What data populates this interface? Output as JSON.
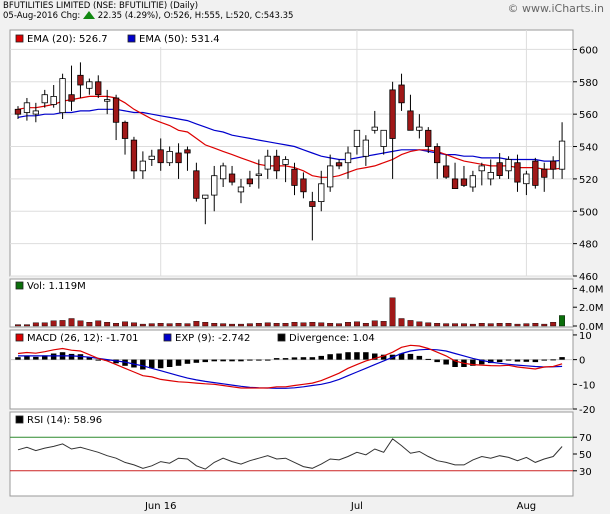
{
  "header": {
    "title": "BFUTILITIES LIMITED (NSE: BFUTILITIE) (Daily)",
    "date": "05-Aug-2016",
    "chg_label": "Chg:",
    "chg_value": "22.35 (4.29%)",
    "ohlc": ", O:526, H:555, L:520, C:543.35",
    "watermark": "© www.iCharts.in"
  },
  "colors": {
    "up": "#ffffff",
    "down": "#a01818",
    "ema20": "#dd0000",
    "ema50": "#0000cc",
    "volume": "#a01818",
    "volume_up": "#0a6e0a",
    "macd": "#000000",
    "rsi_upper": "#2f8a2f",
    "rsi_lower": "#cc2222",
    "chg_arrow": "#118811"
  },
  "chart_data": [
    {
      "type": "candlestick",
      "legend": [
        {
          "name": "EMA (20): 526.7",
          "color": "#dd0000"
        },
        {
          "name": "EMA (50): 531.4",
          "color": "#0000cc"
        }
      ],
      "yticks": [
        460,
        480,
        500,
        520,
        540,
        560,
        580,
        600
      ],
      "ylim": [
        460,
        612
      ],
      "xticks": [
        {
          "label": "Jun 16",
          "i": 16
        },
        {
          "label": "Jul",
          "i": 38
        },
        {
          "label": "Aug",
          "i": 57
        }
      ],
      "ohlc": [
        [
          563,
          565,
          557,
          560
        ],
        [
          561,
          570,
          556,
          567
        ],
        [
          560,
          567,
          555,
          562
        ],
        [
          567,
          575,
          564,
          572
        ],
        [
          566,
          578,
          564,
          571
        ],
        [
          561,
          585,
          557,
          582
        ],
        [
          572,
          590,
          562,
          568
        ],
        [
          584,
          592,
          570,
          578
        ],
        [
          576,
          582,
          572,
          580
        ],
        [
          580,
          584,
          570,
          572
        ],
        [
          568,
          575,
          560,
          569
        ],
        [
          570,
          572,
          544,
          555
        ],
        [
          555,
          556,
          535,
          545
        ],
        [
          544,
          546,
          520,
          525
        ],
        [
          525,
          537,
          520,
          531
        ],
        [
          532,
          538,
          528,
          534
        ],
        [
          538,
          545,
          525,
          530
        ],
        [
          530,
          540,
          528,
          537
        ],
        [
          536,
          542,
          520,
          530
        ],
        [
          538,
          540,
          525,
          536
        ],
        [
          525,
          530,
          506,
          508
        ],
        [
          508,
          510,
          492,
          510
        ],
        [
          510,
          528,
          500,
          522
        ],
        [
          520,
          530,
          515,
          528
        ],
        [
          523,
          528,
          516,
          518
        ],
        [
          512,
          520,
          505,
          515
        ],
        [
          520,
          525,
          515,
          517
        ],
        [
          522,
          532,
          514,
          523
        ],
        [
          526,
          538,
          520,
          534
        ],
        [
          534,
          538,
          520,
          525
        ],
        [
          529,
          534,
          518,
          532
        ],
        [
          526,
          530,
          510,
          516
        ],
        [
          520,
          524,
          508,
          512
        ],
        [
          506,
          512,
          482,
          503
        ],
        [
          506,
          525,
          500,
          517
        ],
        [
          515,
          535,
          512,
          528
        ],
        [
          530,
          532,
          526,
          528
        ],
        [
          530,
          540,
          520,
          536
        ],
        [
          540,
          550,
          535,
          550
        ],
        [
          534,
          547,
          528,
          544
        ],
        [
          550,
          562,
          548,
          552
        ],
        [
          540,
          548,
          535,
          550
        ],
        [
          575,
          580,
          520,
          545
        ],
        [
          578,
          585,
          562,
          567
        ],
        [
          562,
          572,
          550,
          550
        ],
        [
          550,
          560,
          545,
          552
        ],
        [
          550,
          552,
          536,
          540
        ],
        [
          540,
          542,
          520,
          530
        ],
        [
          528,
          535,
          520,
          521
        ],
        [
          520,
          530,
          514,
          514
        ],
        [
          520,
          528,
          515,
          516
        ],
        [
          515,
          525,
          512,
          522
        ],
        [
          525,
          530,
          516,
          528
        ],
        [
          520,
          532,
          516,
          524
        ],
        [
          530,
          536,
          520,
          522
        ],
        [
          525,
          534,
          520,
          532
        ],
        [
          530,
          535,
          512,
          518
        ],
        [
          517,
          525,
          510,
          523
        ],
        [
          531,
          533,
          514,
          516
        ],
        [
          526,
          530,
          512,
          521
        ],
        [
          531,
          534,
          520,
          526
        ],
        [
          526,
          555,
          520,
          543.35
        ]
      ],
      "ema20": [
        563,
        564,
        564,
        565,
        566,
        568,
        569,
        570,
        571,
        571,
        571,
        570,
        567,
        563,
        560,
        557,
        555,
        553,
        550,
        549,
        545,
        541,
        539,
        537,
        535,
        533,
        531,
        529,
        528,
        528,
        528,
        527,
        525,
        522,
        521,
        521,
        522,
        524,
        526,
        527,
        528,
        530,
        532,
        535,
        537,
        538,
        538,
        537,
        535,
        533,
        531,
        530,
        529,
        528,
        528,
        528,
        527,
        527,
        527,
        526,
        526,
        526.7
      ],
      "ema50": [
        558,
        559,
        559,
        560,
        560,
        561,
        561,
        562,
        562,
        563,
        563,
        563,
        562,
        561,
        561,
        560,
        559,
        558,
        557,
        556,
        554,
        552,
        550,
        549,
        547,
        546,
        545,
        544,
        543,
        542,
        541,
        540,
        538,
        536,
        534,
        533,
        532,
        532,
        533,
        534,
        535,
        536,
        537,
        538,
        538,
        538,
        537,
        536,
        535,
        535,
        534,
        534,
        533,
        533,
        533,
        532,
        532,
        532,
        532,
        531,
        531,
        531.4
      ]
    },
    {
      "type": "bar",
      "name": "Vol: 1.119M",
      "yticks": [
        "0.0M",
        "2.0M",
        "4.0M"
      ],
      "ylim": [
        0,
        5
      ],
      "values": [
        0.15,
        0.15,
        0.35,
        0.35,
        0.55,
        0.6,
        0.8,
        0.55,
        0.4,
        0.55,
        0.4,
        0.3,
        0.45,
        0.35,
        0.2,
        0.25,
        0.3,
        0.25,
        0.3,
        0.25,
        0.5,
        0.4,
        0.3,
        0.25,
        0.2,
        0.2,
        0.25,
        0.3,
        0.35,
        0.3,
        0.3,
        0.4,
        0.35,
        0.4,
        0.35,
        0.3,
        0.25,
        0.4,
        0.45,
        0.3,
        0.55,
        0.5,
        3.0,
        0.8,
        0.6,
        0.45,
        0.35,
        0.3,
        0.25,
        0.25,
        0.25,
        0.2,
        0.3,
        0.25,
        0.3,
        0.3,
        0.2,
        0.25,
        0.3,
        0.2,
        0.4,
        1.119
      ]
    },
    {
      "type": "line",
      "legend": [
        {
          "name": "MACD (26, 12): -1.701",
          "color": "#dd0000"
        },
        {
          "name": "EXP (9): -2.742",
          "color": "#0000cc"
        },
        {
          "name": "Divergence: 1.04",
          "color": "#000000"
        }
      ],
      "yticks": [
        -20,
        -10,
        0,
        10
      ],
      "ylim": [
        -20,
        12
      ],
      "macd": [
        2.5,
        2.9,
        2.6,
        3.2,
        4.0,
        4.5,
        3.8,
        3.5,
        2.0,
        0.5,
        -0.5,
        -2.0,
        -3.5,
        -5.0,
        -6.5,
        -7.0,
        -8.0,
        -8.5,
        -9.0,
        -9.2,
        -9.5,
        -9.8,
        -10.0,
        -10.5,
        -11.0,
        -11.5,
        -11.5,
        -11.5,
        -11.5,
        -11.0,
        -11.0,
        -10.5,
        -10.0,
        -9.5,
        -8.5,
        -7.0,
        -5.5,
        -3.5,
        -2.0,
        -0.5,
        0.5,
        1.5,
        3.0,
        5.0,
        5.8,
        5.5,
        4.5,
        3.0,
        1.5,
        -0.5,
        -1.5,
        -2.0,
        -2.2,
        -2.4,
        -2.5,
        -2.3,
        -3.0,
        -3.4,
        -3.8,
        -3.0,
        -2.8,
        -1.701
      ],
      "exp": [
        1.5,
        1.5,
        1.5,
        1.5,
        1.5,
        1.5,
        1.5,
        1.3,
        1.0,
        0.5,
        0.0,
        -0.5,
        -1.0,
        -1.8,
        -2.5,
        -3.5,
        -4.5,
        -5.5,
        -6.5,
        -7.5,
        -8.2,
        -8.8,
        -9.3,
        -9.8,
        -10.3,
        -10.8,
        -11.2,
        -11.4,
        -11.5,
        -11.6,
        -11.6,
        -11.4,
        -11.0,
        -10.5,
        -10.0,
        -9.2,
        -8.0,
        -6.5,
        -5.0,
        -3.5,
        -2.0,
        -0.5,
        1.0,
        2.5,
        3.5,
        4.0,
        4.2,
        4.0,
        3.5,
        2.5,
        1.5,
        0.5,
        -0.3,
        -1.0,
        -1.5,
        -1.9,
        -2.2,
        -2.5,
        -2.8,
        -3.0,
        -2.9,
        -2.742
      ],
      "divergence": [
        1.0,
        1.4,
        1.1,
        1.7,
        2.5,
        3.0,
        2.3,
        2.2,
        1.0,
        0.0,
        -0.5,
        -1.5,
        -2.5,
        -3.2,
        -4.0,
        -3.5,
        -3.5,
        -3.0,
        -2.5,
        -1.7,
        -1.3,
        -1.0,
        -0.7,
        -0.7,
        -0.7,
        -0.7,
        -0.3,
        -0.1,
        0.0,
        0.6,
        0.6,
        0.9,
        1.0,
        1.0,
        1.5,
        2.2,
        2.5,
        3.0,
        3.0,
        3.0,
        2.5,
        2.0,
        2.0,
        2.5,
        2.3,
        1.5,
        0.3,
        -1.0,
        -2.0,
        -3.0,
        -3.0,
        -2.5,
        -1.9,
        -1.4,
        -1.0,
        -0.4,
        -0.8,
        -0.9,
        -1.0,
        0.0,
        0.1,
        1.04
      ]
    },
    {
      "type": "line",
      "legend": [
        {
          "name": "RSI (14): 58.96",
          "color": "#000000"
        }
      ],
      "yticks": [
        30,
        50,
        70
      ],
      "ylim": [
        0,
        100
      ],
      "levels": {
        "upper": 70,
        "lower": 30
      },
      "values": [
        55,
        58,
        54,
        57,
        59,
        62,
        56,
        58,
        55,
        52,
        48,
        45,
        40,
        37,
        33,
        36,
        41,
        39,
        45,
        44,
        36,
        32,
        40,
        45,
        41,
        38,
        42,
        45,
        48,
        44,
        45,
        40,
        35,
        33,
        38,
        44,
        43,
        47,
        52,
        49,
        56,
        52,
        68,
        60,
        51,
        53,
        47,
        42,
        40,
        37,
        37,
        43,
        47,
        45,
        48,
        46,
        42,
        46,
        40,
        44,
        47,
        58.96
      ]
    }
  ]
}
